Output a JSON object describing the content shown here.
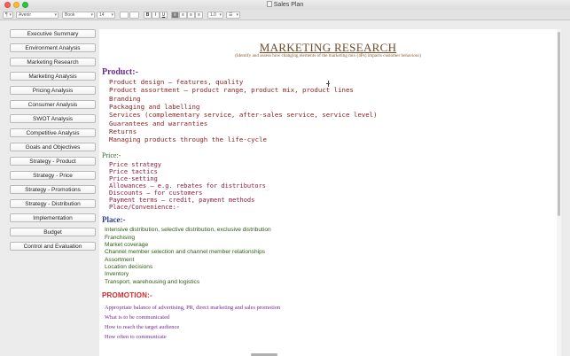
{
  "window": {
    "title": "Sales Plan"
  },
  "toolbar": {
    "paragraph_style": "¶",
    "font_family": "Avenir",
    "font_style": "Book",
    "font_size": "14",
    "bold_label": "B",
    "italic_label": "I",
    "underline_label": "U",
    "line_spacing": "1.0",
    "list_style": "☰",
    "caret": "▾"
  },
  "sidebar": {
    "items": [
      {
        "label": "Executive Summary"
      },
      {
        "label": "Environment Analysis"
      },
      {
        "label": "Marketing Research"
      },
      {
        "label": "Marketing Analysis"
      },
      {
        "label": "Pricing Analysis"
      },
      {
        "label": "Consumer Analysis"
      },
      {
        "label": "SWOT Analysis"
      },
      {
        "label": "Competitive Analysis"
      },
      {
        "label": "Goals and Objectives"
      },
      {
        "label": "Strategy - Product"
      },
      {
        "label": "Strategy - Price"
      },
      {
        "label": "Strategy - Promotions"
      },
      {
        "label": "Strategy - Distribution"
      },
      {
        "label": "Implementation"
      },
      {
        "label": "Budget"
      },
      {
        "label": "Control and Evaluation"
      }
    ]
  },
  "document": {
    "heading": "MARKETING RESEARCH",
    "subheading": "(Identify and assess how changing elements of the marketing mix (4Ps) impacts customer behaviour)",
    "product": {
      "title": "Product:-",
      "items": [
        "Product design – features, quality",
        "Product assortment – product range, product mix, product lines",
        "Branding",
        "Packaging and labelling",
        "Services (complementary service, after-sales service, service level)",
        "Guarantees and warranties",
        "Returns",
        "Managing products through the life-cycle"
      ]
    },
    "price": {
      "title": "Price:-",
      "items": [
        "Price strategy",
        "Price tactics",
        "Price-setting",
        "Allowances – e.g. rebates for distributors",
        "Discounts – for customers",
        "Payment terms – credit, payment methods",
        "Place/Convenience:-"
      ]
    },
    "place": {
      "title": "Place:-",
      "items": [
        "Intensive distribution, selective distribution, exclusive distribution",
        "Franchising",
        "Market coverage",
        "Channel member selection and channel member relationships",
        "Assortment",
        "Location decisions",
        "Inventory",
        "Transport, warehousing and logistics"
      ]
    },
    "promotion": {
      "title": "PROMOTION:-",
      "items": [
        "Appropriate balance of advertising, PR, direct marketing and sales promotion",
        "What is to be communicated",
        "How to reach the target audience",
        "How often to communicate"
      ]
    }
  }
}
